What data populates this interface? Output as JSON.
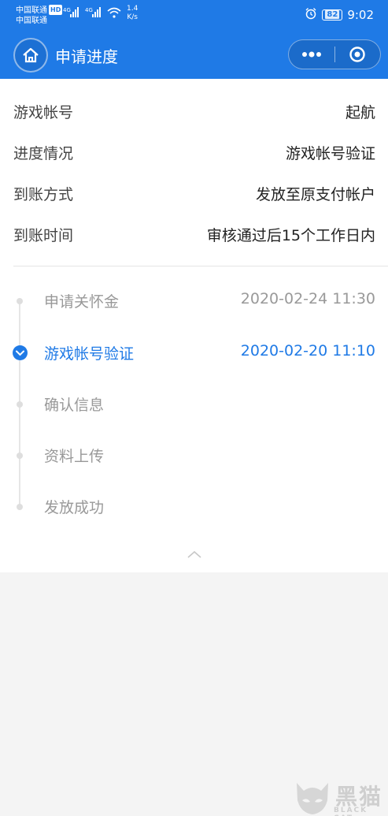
{
  "status_bar": {
    "carrier1": "中国联通",
    "carrier1_badge": "HD",
    "carrier2": "中国联通",
    "net1": "4G",
    "net2": "4G",
    "speed_value": "1.4",
    "speed_unit": "K/s",
    "battery": "82",
    "time": "9:02"
  },
  "navbar": {
    "title": "申请进度"
  },
  "info": [
    {
      "label": "游戏帐号",
      "value": "起航"
    },
    {
      "label": "进度情况",
      "value": "游戏帐号验证"
    },
    {
      "label": "到账方式",
      "value": "发放至原支付帐户"
    },
    {
      "label": "到账时间",
      "value": "审核通过后15个工作日内"
    }
  ],
  "timeline": [
    {
      "label": "申请关怀金",
      "time": "2020-02-24 11:30",
      "state": "done"
    },
    {
      "label": "游戏帐号验证",
      "time": "2020-02-20 11:10",
      "state": "active"
    },
    {
      "label": "确认信息",
      "time": "",
      "state": "pending"
    },
    {
      "label": "资料上传",
      "time": "",
      "state": "pending"
    },
    {
      "label": "发放成功",
      "time": "",
      "state": "pending"
    }
  ],
  "watermark": {
    "text": "黑猫",
    "sub": "BLACK CAT"
  },
  "colors": {
    "brand": "#1f7ae6",
    "inactive": "#999999",
    "background": "#f4f4f4"
  }
}
